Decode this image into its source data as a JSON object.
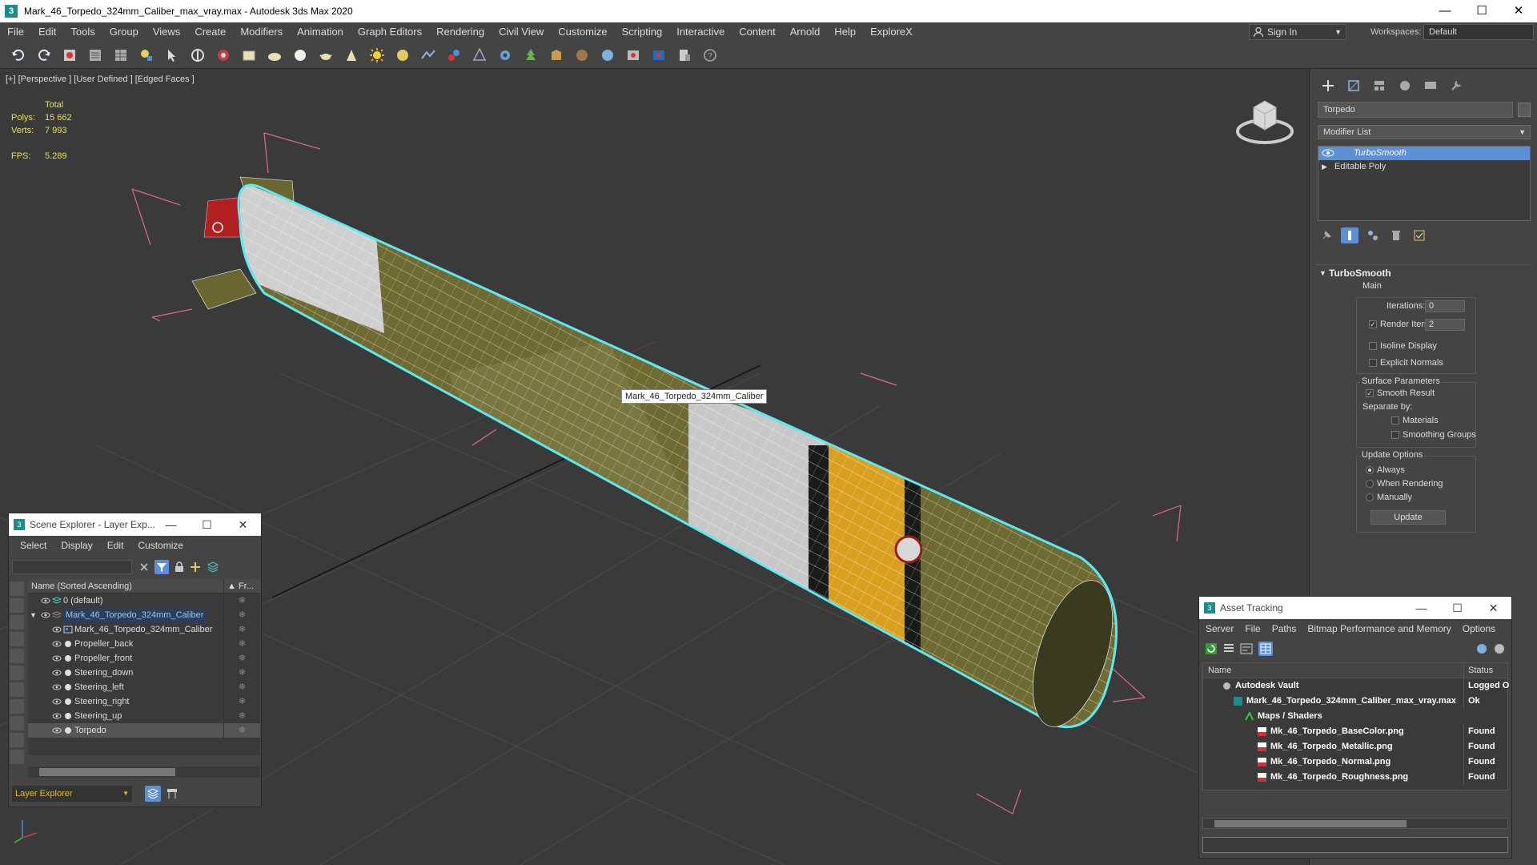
{
  "window": {
    "title": "Mark_46_Torpedo_324mm_Caliber_max_vray.max - Autodesk 3ds Max 2020",
    "app_icon": "3",
    "minimize": "—",
    "maximize": "☐",
    "close": "✕"
  },
  "menu": [
    "File",
    "Edit",
    "Tools",
    "Group",
    "Views",
    "Create",
    "Modifiers",
    "Animation",
    "Graph Editors",
    "Rendering",
    "Civil View",
    "Customize",
    "Scripting",
    "Interactive",
    "Content",
    "Arnold",
    "Help",
    "ExploreX"
  ],
  "signin": {
    "label": "Sign In"
  },
  "workspaces": {
    "label": "Workspaces:",
    "value": "Default"
  },
  "viewport": {
    "label": "[+] [Perspective ] [User Defined ] [Edged Faces ]",
    "stats": {
      "header": "Total",
      "polys_label": "Polys:",
      "polys": "15 662",
      "verts_label": "Verts:",
      "verts": "7 993",
      "fps_label": "FPS:",
      "fps": "5.289"
    },
    "object_tooltip": "Mark_46_Torpedo_324mm_Caliber"
  },
  "command_panel": {
    "object_name": "Torpedo",
    "modifier_list": "Modifier List",
    "stack": [
      "TurboSmooth",
      "Editable Poly"
    ],
    "rollout_title": "TurboSmooth",
    "main_label": "Main",
    "iterations_label": "Iterations:",
    "iterations": "0",
    "render_iters_label": "Render Iters:",
    "render_iters": "2",
    "isoline_display": "Isoline Display",
    "explicit_normals": "Explicit Normals",
    "surface_params": "Surface Parameters",
    "smooth_result": "Smooth Result",
    "separate_by": "Separate by:",
    "materials": "Materials",
    "smoothing_groups": "Smoothing Groups",
    "update_options": "Update Options",
    "always": "Always",
    "when_rendering": "When Rendering",
    "manually": "Manually",
    "update_button": "Update"
  },
  "scene_explorer": {
    "title": "Scene Explorer - Layer Exp...",
    "menu": [
      "Select",
      "Display",
      "Edit",
      "Customize"
    ],
    "col_name": "Name (Sorted Ascending)",
    "col_fr": "▲ Fr...",
    "rows": [
      {
        "label": "0 (default)"
      },
      {
        "label": "Mark_46_Torpedo_324mm_Caliber"
      },
      {
        "label": "Mark_46_Torpedo_324mm_Caliber"
      },
      {
        "label": "Propeller_back"
      },
      {
        "label": "Propeller_front"
      },
      {
        "label": "Steering_down"
      },
      {
        "label": "Steering_left"
      },
      {
        "label": "Steering_right"
      },
      {
        "label": "Steering_up"
      },
      {
        "label": "Torpedo"
      }
    ],
    "layer_explorer": "Layer Explorer"
  },
  "asset_tracking": {
    "title": "Asset Tracking",
    "menu": [
      "Server",
      "File",
      "Paths",
      "Bitmap Performance and Memory",
      "Options"
    ],
    "col_name": "Name",
    "col_status": "Status",
    "rows": [
      {
        "name": "Autodesk Vault",
        "status": "Logged Ou"
      },
      {
        "name": "Mark_46_Torpedo_324mm_Caliber_max_vray.max",
        "status": "Ok"
      },
      {
        "name": "Maps / Shaders",
        "status": ""
      },
      {
        "name": "Mk_46_Torpedo_BaseColor.png",
        "status": "Found"
      },
      {
        "name": "Mk_46_Torpedo_Metallic.png",
        "status": "Found"
      },
      {
        "name": "Mk_46_Torpedo_Normal.png",
        "status": "Found"
      },
      {
        "name": "Mk_46_Torpedo_Roughness.png",
        "status": "Found"
      }
    ]
  },
  "colors": {
    "selection_outline": "#5ee8f0",
    "torpedo_body": "#6e6a32",
    "torpedo_band": "#d9a020",
    "bbox": "#e06a8a",
    "accent_select": "#5b8fd6"
  }
}
